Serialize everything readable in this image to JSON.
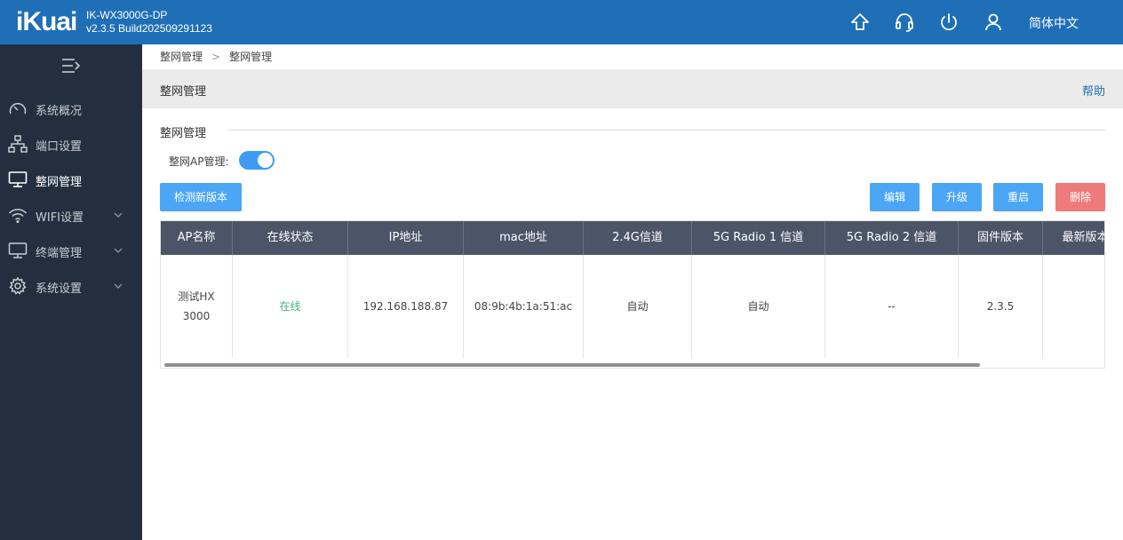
{
  "header": {
    "logo": "iKuai",
    "model": "IK-WX3000G-DP",
    "version": "v2.3.5 Build202509291123",
    "language": "简体中文",
    "icons": [
      "upgrade-icon",
      "headset-support-icon",
      "power-icon",
      "user-icon"
    ]
  },
  "sidebar": {
    "items": [
      {
        "label": "系统概况",
        "icon": "dashboard-gauge-icon"
      },
      {
        "label": "端口设置",
        "icon": "network-topology-icon"
      },
      {
        "label": "整网管理",
        "icon": "monitor-icon"
      },
      {
        "label": "WIFI设置",
        "icon": "wifi-icon"
      },
      {
        "label": "终端管理",
        "icon": "terminal-monitor-icon"
      },
      {
        "label": "系统设置",
        "icon": "gear-icon"
      }
    ]
  },
  "breadcrumb": {
    "root": "整网管理",
    "sep": ">",
    "current": "整网管理"
  },
  "page": {
    "title": "整网管理",
    "help": "帮助"
  },
  "section": {
    "title": "整网管理",
    "switch_label": "整网AP管理:",
    "switch_on": true
  },
  "actions": {
    "check_version": "检测新版本",
    "edit": "编辑",
    "upgrade": "升级",
    "restart": "重启",
    "delete": "删除"
  },
  "colors": {
    "header": "#1f6fb7",
    "sidebar": "#232f3e",
    "primary": "#4ba6f6",
    "danger": "#ef7a7a",
    "online": "#3fb27f",
    "table_head": "#4c5568"
  },
  "table": {
    "columns": [
      "AP名称",
      "在线状态",
      "IP地址",
      "mac地址",
      "2.4G信道",
      "5G Radio 1 信道",
      "5G Radio 2 信道",
      "固件版本",
      "最新版本"
    ],
    "rows": [
      {
        "name_line1": "测试HX",
        "name_line2": "3000",
        "status": "在线",
        "ip": "192.168.188.87",
        "mac": "08:9b:4b:1a:51:ac",
        "ch24": "自动",
        "ch5_1": "自动",
        "ch5_2": "--",
        "firmware": "2.3.5",
        "latest": ""
      }
    ]
  }
}
